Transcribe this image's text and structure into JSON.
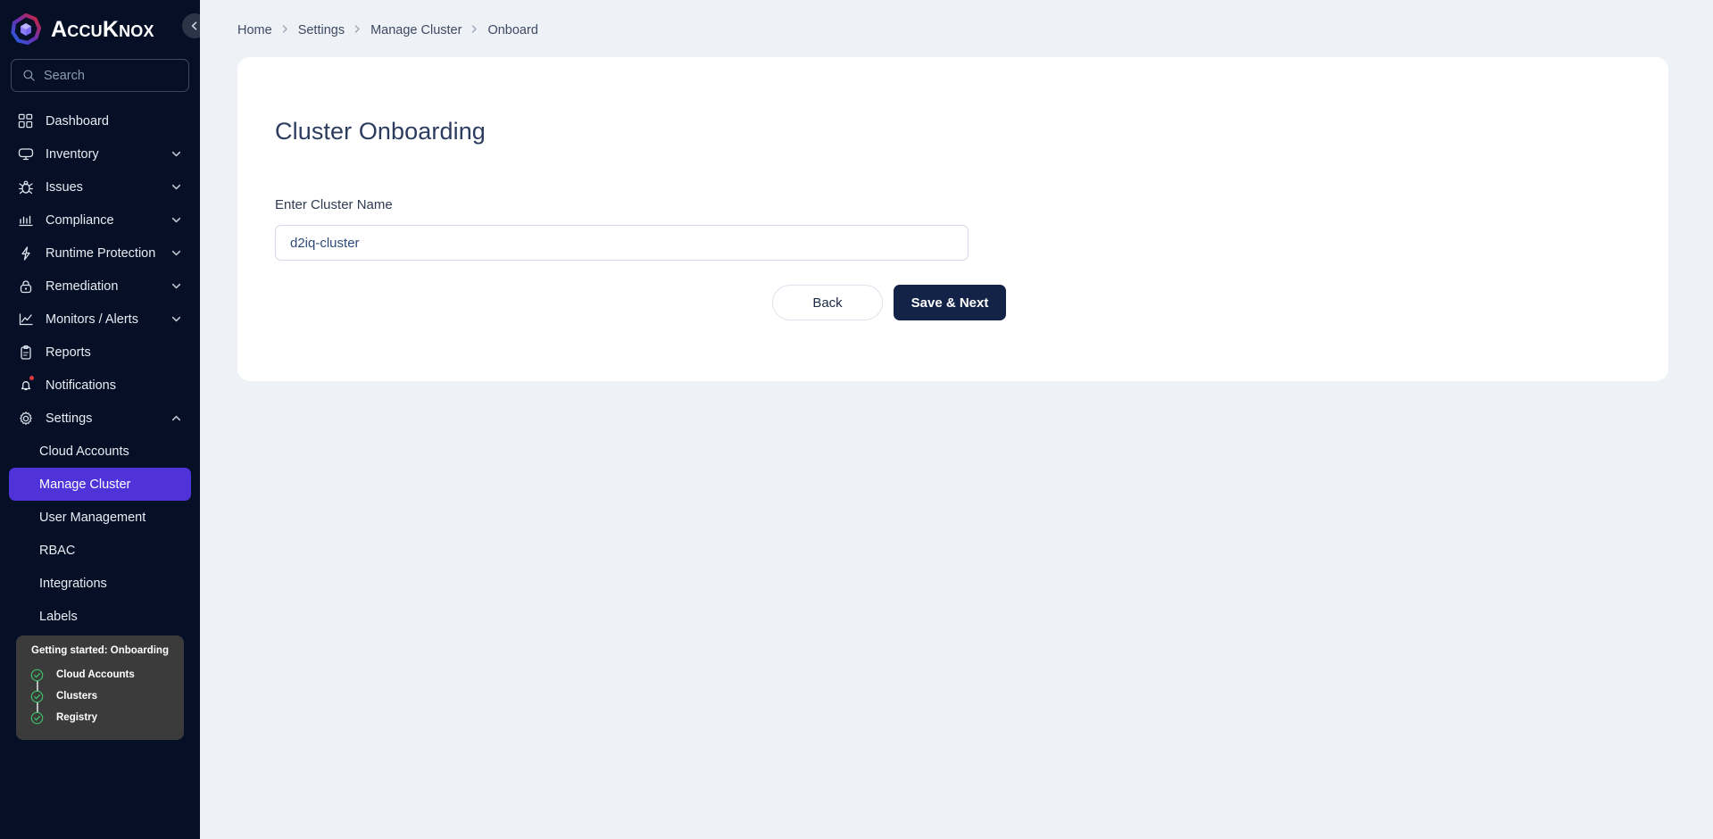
{
  "brand": {
    "name": "AccuKnox",
    "logo_icon": "accuknox-cube-logo",
    "collapse_icon": "chevron-left-icon"
  },
  "search": {
    "placeholder": "Search",
    "icon": "search-icon",
    "value": ""
  },
  "sidebar": {
    "items": [
      {
        "label": "Dashboard",
        "icon": "grid-icon",
        "expandable": false,
        "chevron": ""
      },
      {
        "label": "Inventory",
        "icon": "monitor-icon",
        "expandable": true,
        "chevron": "chevron-down-icon"
      },
      {
        "label": "Issues",
        "icon": "bug-icon",
        "expandable": true,
        "chevron": "chevron-down-icon"
      },
      {
        "label": "Compliance",
        "icon": "chart-icon",
        "expandable": true,
        "chevron": "chevron-down-icon"
      },
      {
        "label": "Runtime Protection",
        "icon": "bolt-icon",
        "expandable": true,
        "chevron": "chevron-down-icon"
      },
      {
        "label": "Remediation",
        "icon": "lock-icon",
        "expandable": true,
        "chevron": "chevron-down-icon"
      },
      {
        "label": "Monitors / Alerts",
        "icon": "line-chart-icon",
        "expandable": true,
        "chevron": "chevron-down-icon"
      },
      {
        "label": "Reports",
        "icon": "clipboard-icon",
        "expandable": false,
        "chevron": ""
      },
      {
        "label": "Notifications",
        "icon": "bell-icon",
        "expandable": false,
        "chevron": "",
        "badge": true
      },
      {
        "label": "Settings",
        "icon": "gear-icon",
        "expandable": true,
        "chevron": "chevron-up-icon",
        "expanded": true
      }
    ],
    "settings_children": [
      {
        "label": "Cloud Accounts",
        "active": false
      },
      {
        "label": "Manage Cluster",
        "active": true
      },
      {
        "label": "User Management",
        "active": false
      },
      {
        "label": "RBAC",
        "active": false
      },
      {
        "label": "Integrations",
        "active": false
      },
      {
        "label": "Labels",
        "active": false
      }
    ],
    "active_item": "Manage Cluster",
    "active_color": "#4f33d9"
  },
  "getting_started": {
    "title": "Getting started: Onboarding",
    "steps": [
      {
        "label": "Cloud Accounts",
        "status": "complete",
        "icon": "check-circle-icon"
      },
      {
        "label": "Clusters",
        "status": "complete",
        "icon": "check-circle-icon"
      },
      {
        "label": "Registry",
        "status": "complete",
        "icon": "check-circle-icon"
      }
    ],
    "check_color": "#3ebd6b"
  },
  "breadcrumb": {
    "items": [
      "Home",
      "Settings",
      "Manage Cluster",
      "Onboard"
    ],
    "separator_icon": "chevron-right-icon"
  },
  "main": {
    "card_title": "Cluster Onboarding",
    "field_label": "Enter Cluster Name",
    "cluster_name_value": "d2iq-cluster",
    "cluster_name_placeholder": "Enter Cluster Name",
    "back_label": "Back",
    "save_next_label": "Save & Next"
  }
}
